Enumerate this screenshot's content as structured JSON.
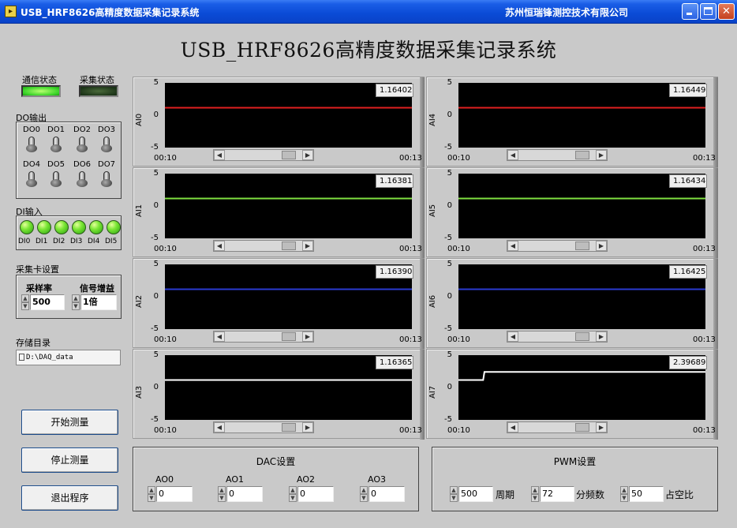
{
  "window": {
    "title": "USB_HRF8626高精度数据采集记录系统",
    "company": "苏州恒瑞锋测控技术有限公司",
    "icon_text": "▸"
  },
  "main_title": "USB_HRF8626高精度数据采集记录系统",
  "status": {
    "comm_label": "通信状态",
    "comm_on": true,
    "acq_label": "采集状态",
    "acq_on": false
  },
  "do_output": {
    "title": "DO输出",
    "switches": [
      "DO0",
      "DO1",
      "DO2",
      "DO3",
      "DO4",
      "DO5",
      "DO6",
      "DO7"
    ]
  },
  "di_input": {
    "title": "DI输入",
    "leds": [
      "DI0",
      "DI1",
      "DI2",
      "DI3",
      "DI4",
      "DI5"
    ]
  },
  "card_settings": {
    "title": "采集卡设置",
    "sample_rate_label": "采样率",
    "sample_rate_value": "500",
    "gain_label": "信号增益",
    "gain_value": "1倍"
  },
  "storage": {
    "title": "存储目录",
    "path": "D:\\DAQ_data"
  },
  "buttons": {
    "start": "开始测量",
    "stop": "停止测量",
    "exit": "退出程序"
  },
  "colors": {
    "AI0": "#e02020",
    "AI1": "#7fe040",
    "AI2": "#2a3ad0",
    "AI3": "#ffffff",
    "AI4": "#e02020",
    "AI5": "#7fe040",
    "AI6": "#2a3ad0",
    "AI7": "#ffffff"
  },
  "charts": [
    {
      "name": "AI0",
      "readout": "1.16402",
      "yticks": [
        "5",
        "0",
        "-5"
      ],
      "xstart": "00:10",
      "xend": "00:13"
    },
    {
      "name": "AI1",
      "readout": "1.16381",
      "yticks": [
        "5",
        "0",
        "-5"
      ],
      "xstart": "00:10",
      "xend": "00:13"
    },
    {
      "name": "AI2",
      "readout": "1.16390",
      "yticks": [
        "5",
        "0",
        "-5"
      ],
      "xstart": "00:10",
      "xend": "00:13"
    },
    {
      "name": "AI3",
      "readout": "1.16365",
      "yticks": [
        "5",
        "0",
        "-5"
      ],
      "xstart": "00:10",
      "xend": "00:13"
    },
    {
      "name": "AI4",
      "readout": "1.16449",
      "yticks": [
        "5",
        "0",
        "-5"
      ],
      "xstart": "00:10",
      "xend": "00:13"
    },
    {
      "name": "AI5",
      "readout": "1.16434",
      "yticks": [
        "5",
        "0",
        "-5"
      ],
      "xstart": "00:10",
      "xend": "00:13"
    },
    {
      "name": "AI6",
      "readout": "1.16425",
      "yticks": [
        "5",
        "0",
        "-5"
      ],
      "xstart": "00:10",
      "xend": "00:13"
    },
    {
      "name": "AI7",
      "readout": "2.39689",
      "yticks": [
        "5",
        "0",
        "-5"
      ],
      "xstart": "00:10",
      "xend": "00:13"
    }
  ],
  "chart_data": [
    {
      "type": "line",
      "ylabel": "AI0",
      "ylim": [
        -5,
        5
      ],
      "xlim": [
        "00:10",
        "00:13"
      ],
      "series": [
        {
          "x": [
            0,
            1
          ],
          "values": [
            1.164,
            1.164
          ]
        }
      ],
      "grid": false
    },
    {
      "type": "line",
      "ylabel": "AI1",
      "ylim": [
        -5,
        5
      ],
      "xlim": [
        "00:10",
        "00:13"
      ],
      "series": [
        {
          "x": [
            0,
            1
          ],
          "values": [
            1.164,
            1.164
          ]
        }
      ],
      "grid": false
    },
    {
      "type": "line",
      "ylabel": "AI2",
      "ylim": [
        -5,
        5
      ],
      "xlim": [
        "00:10",
        "00:13"
      ],
      "series": [
        {
          "x": [
            0,
            1
          ],
          "values": [
            1.164,
            1.164
          ]
        }
      ],
      "grid": false
    },
    {
      "type": "line",
      "ylabel": "AI3",
      "ylim": [
        -5,
        5
      ],
      "xlim": [
        "00:10",
        "00:13"
      ],
      "series": [
        {
          "x": [
            0,
            1
          ],
          "values": [
            1.164,
            1.164
          ]
        }
      ],
      "grid": false
    },
    {
      "type": "line",
      "ylabel": "AI4",
      "ylim": [
        -5,
        5
      ],
      "xlim": [
        "00:10",
        "00:13"
      ],
      "series": [
        {
          "x": [
            0,
            1
          ],
          "values": [
            1.164,
            1.164
          ]
        }
      ],
      "grid": false
    },
    {
      "type": "line",
      "ylabel": "AI5",
      "ylim": [
        -5,
        5
      ],
      "xlim": [
        "00:10",
        "00:13"
      ],
      "series": [
        {
          "x": [
            0,
            1
          ],
          "values": [
            1.164,
            1.164
          ]
        }
      ],
      "grid": false
    },
    {
      "type": "line",
      "ylabel": "AI6",
      "ylim": [
        -5,
        5
      ],
      "xlim": [
        "00:10",
        "00:13"
      ],
      "series": [
        {
          "x": [
            0,
            1
          ],
          "values": [
            1.164,
            1.164
          ]
        }
      ],
      "grid": false
    },
    {
      "type": "line",
      "ylabel": "AI7",
      "ylim": [
        -5,
        5
      ],
      "xlim": [
        "00:10",
        "00:13"
      ],
      "series": [
        {
          "x": [
            0,
            0.1,
            0.105,
            1
          ],
          "values": [
            1.16,
            1.16,
            2.397,
            2.397
          ]
        }
      ],
      "grid": false
    }
  ],
  "dac": {
    "title": "DAC设置",
    "channels": [
      {
        "label": "AO0",
        "value": "0"
      },
      {
        "label": "AO1",
        "value": "0"
      },
      {
        "label": "AO2",
        "value": "0"
      },
      {
        "label": "AO3",
        "value": "0"
      }
    ]
  },
  "pwm": {
    "title": "PWM设置",
    "period_value": "500",
    "period_label": "周期",
    "div_value": "72",
    "div_label": "分频数",
    "duty_value": "50",
    "duty_label": "占空比"
  }
}
